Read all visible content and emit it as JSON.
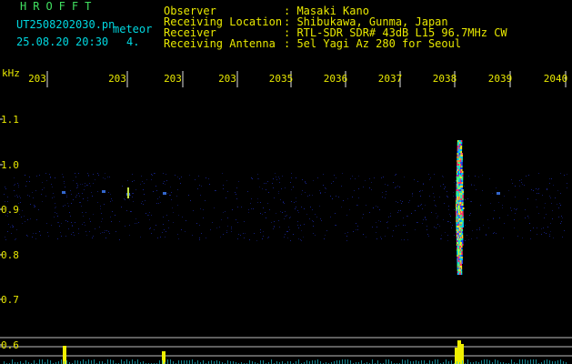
{
  "header": {
    "app_name": "HROFFT",
    "file_name": "UT2508202030.pn",
    "file_tail": "meteor",
    "datetime": "25.08.20 20:30",
    "count": "4.",
    "observer_label": "Observer",
    "observer_value": ": Masaki Kano",
    "location_label": "Receiving Location",
    "location_value": ": Shibukawa, Gunma, Japan",
    "receiver_label": "Receiver",
    "receiver_value": ": RTL-SDR SDR# 43dB L15 96.7MHz CW",
    "antenna_label": "Receiving Antenna",
    "antenna_value": ": 5el Yagi Az 280 for Seoul"
  },
  "axes": {
    "y_unit": "kHz",
    "y_ticks": [
      "1.1",
      "1.0",
      "0.9",
      "0.8",
      "0.7",
      "0.6"
    ],
    "x_ticks": [
      "203",
      "203",
      "203",
      "203",
      "2035",
      "2036",
      "2037",
      "2038",
      "2039",
      "2040"
    ]
  },
  "colors": {
    "background": "#000000",
    "label_cyan": "#00d8e0",
    "label_yellow": "#e8e800",
    "title_green": "#40e060",
    "grid_white": "#e0e0e0",
    "noise_blue": "#2030c0"
  }
}
